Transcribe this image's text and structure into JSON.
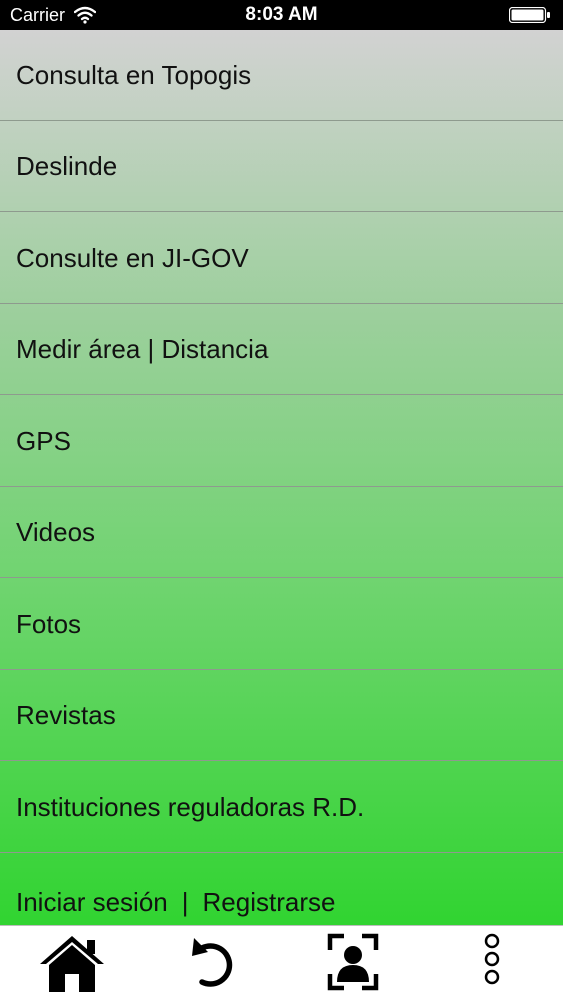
{
  "status_bar": {
    "carrier": "Carrier",
    "time": "8:03 AM"
  },
  "menu": {
    "items": [
      {
        "label": "Consulta en Topogis"
      },
      {
        "label": "Deslinde"
      },
      {
        "label": "Consulte en JI-GOV"
      },
      {
        "label": "Medir área | Distancia"
      },
      {
        "label": "GPS"
      },
      {
        "label": "Videos"
      },
      {
        "label": "Fotos"
      },
      {
        "label": "Revistas"
      },
      {
        "label": "Instituciones reguladoras R.D."
      }
    ],
    "login_label": "Iniciar sesión",
    "separator": "|",
    "register_label": "Registrarse"
  },
  "tab_bar": {
    "icons": [
      "home-icon",
      "undo-icon",
      "profile-scan-icon",
      "more-vertical-icon"
    ]
  }
}
